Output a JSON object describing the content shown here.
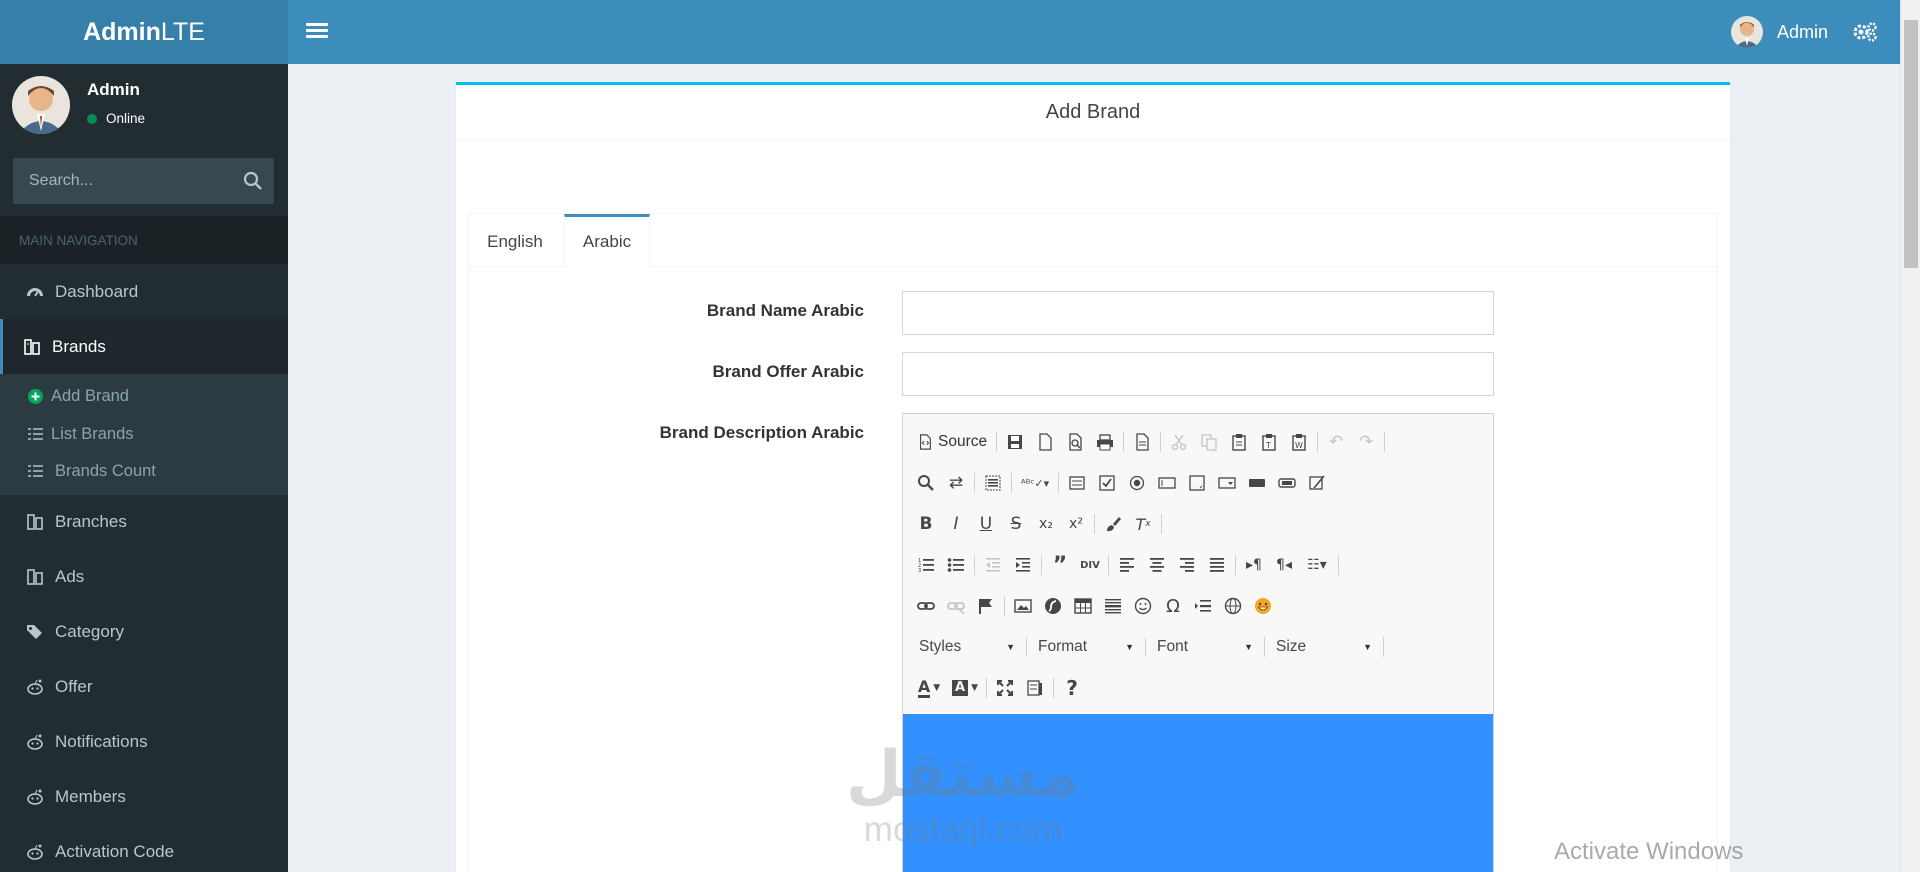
{
  "header": {
    "logo_bold": "Admin",
    "logo_light": "LTE",
    "user_name": "Admin"
  },
  "sidebar": {
    "user_name": "Admin",
    "status": "Online",
    "search_placeholder": "Search...",
    "nav_header": "MAIN NAVIGATION",
    "items": [
      {
        "label": "Dashboard",
        "icon": "dashboard-icon"
      },
      {
        "label": "Brands",
        "icon": "brand-icon"
      },
      {
        "label": "Branches",
        "icon": "brand-icon"
      },
      {
        "label": "Ads",
        "icon": "brand-icon"
      },
      {
        "label": "Category",
        "icon": "tags-icon"
      },
      {
        "label": "Offer",
        "icon": "reddit-icon"
      },
      {
        "label": "Notifications",
        "icon": "reddit-icon"
      },
      {
        "label": "Members",
        "icon": "reddit-icon"
      },
      {
        "label": "Activation Code",
        "icon": "reddit-icon"
      }
    ],
    "brands_sub": [
      {
        "label": "Add Brand",
        "icon": "plus-circle-icon"
      },
      {
        "label": "List Brands",
        "icon": "list-icon"
      },
      {
        "label": "Brands Count",
        "icon": "list-icon"
      }
    ]
  },
  "content": {
    "title": "Add Brand",
    "tabs": [
      "English",
      "Arabic"
    ],
    "active_tab": "Arabic",
    "fields": {
      "name_label": "Brand Name Arabic",
      "offer_label": "Brand Offer Arabic",
      "desc_label": "Brand Description Arabic"
    }
  },
  "editor": {
    "source_label": "Source",
    "combos": [
      "Styles",
      "Format",
      "Font",
      "Size"
    ],
    "content_color": "#3391ff"
  },
  "overlays": {
    "watermark_ar": "مستقل",
    "watermark_lat": "mostaql.com",
    "activate": "Activate Windows"
  },
  "colors": {
    "header": "#3c8dbc",
    "logo": "#367fa9",
    "sidebar": "#222d32",
    "box_border": "#00c0ef"
  }
}
